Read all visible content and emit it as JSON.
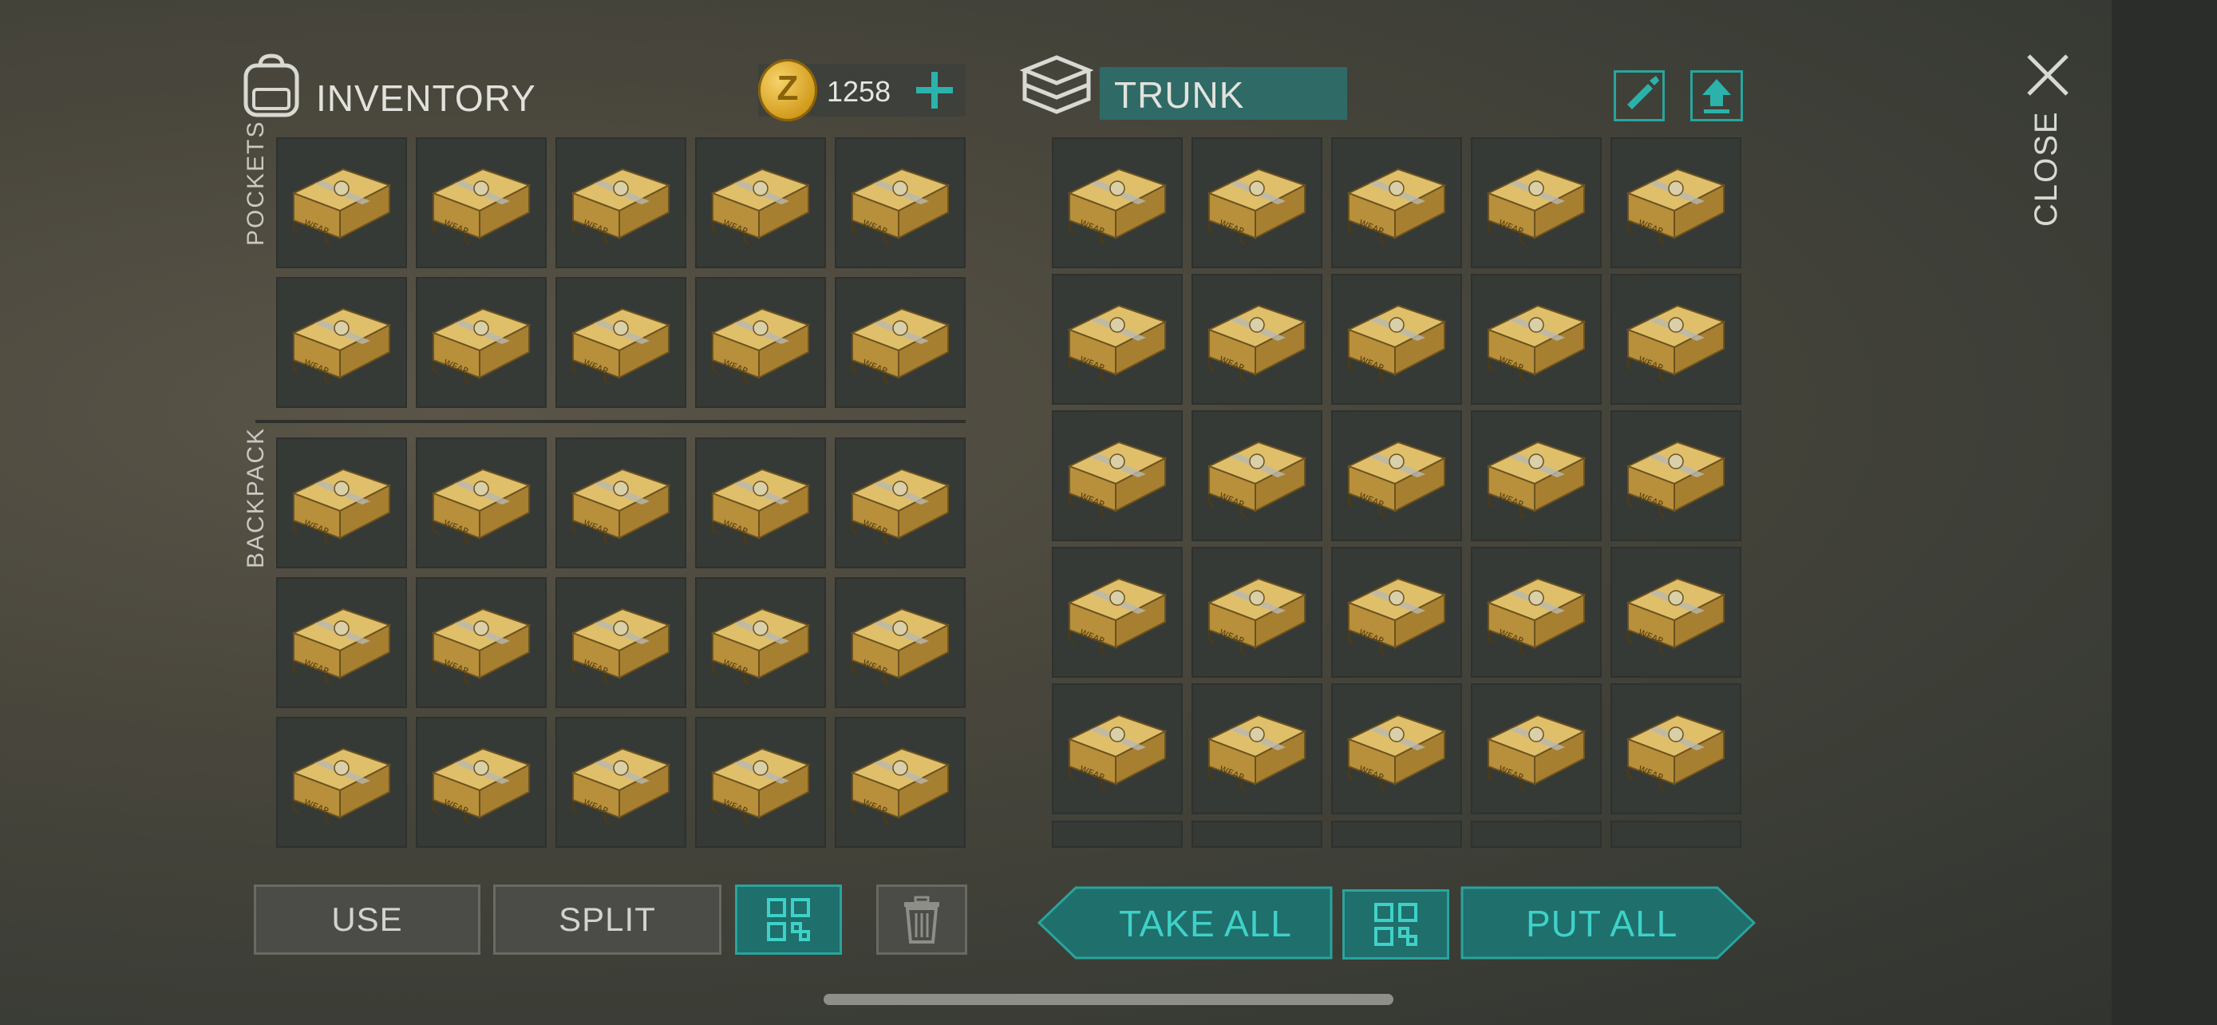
{
  "inventory": {
    "title": "INVENTORY",
    "coins": "1258",
    "coin_symbol": "Z",
    "pockets_label": "POCKETS",
    "backpack_label": "BACKPACK",
    "pockets_rows": 2,
    "backpack_rows": 3,
    "columns": 5,
    "item": "weapon-crate"
  },
  "trunk": {
    "title": "TRUNK",
    "rows": 5,
    "columns": 5,
    "item": "weapon-crate"
  },
  "close_label": "CLOSE",
  "buttons": {
    "use": "USE",
    "split": "SPLIT",
    "take_all": "TAKE ALL",
    "put_all": "PUT ALL"
  },
  "colors": {
    "accent": "#3fd1c7",
    "teal_bg": "#1f6f6c",
    "slot_bg": "#363a36",
    "crate": "#c9a14a"
  }
}
